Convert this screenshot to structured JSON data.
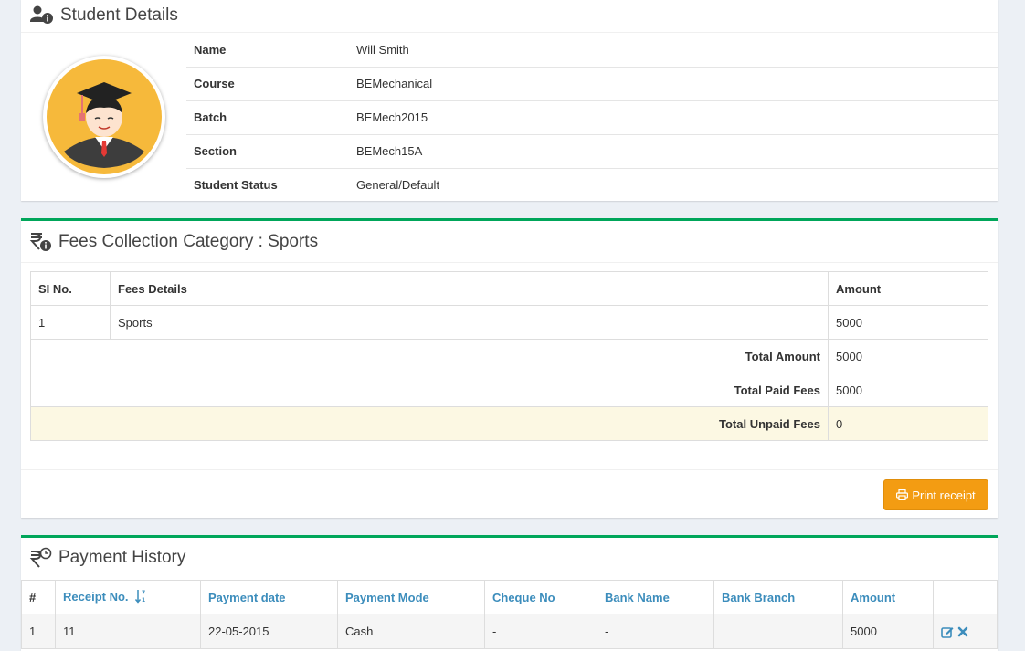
{
  "student": {
    "title": "Student Details",
    "rows": [
      {
        "label": "Name",
        "value": "Will Smith"
      },
      {
        "label": "Course",
        "value": "BEMechanical"
      },
      {
        "label": "Batch",
        "value": "BEMech2015"
      },
      {
        "label": "Section",
        "value": "BEMech15A"
      },
      {
        "label": "Student Status",
        "value": "General/Default"
      }
    ],
    "avatar_icon": "graduate-avatar-icon"
  },
  "fees": {
    "title": "Fees Collection Category : Sports",
    "headers": [
      "SI No.",
      "Fees Details",
      "Amount"
    ],
    "rows": [
      {
        "si": "1",
        "details": "Sports",
        "amount": "5000"
      }
    ],
    "totals": [
      {
        "label": "Total Amount",
        "value": "5000"
      },
      {
        "label": "Total Paid Fees",
        "value": "5000"
      },
      {
        "label": "Total Unpaid Fees",
        "value": "0"
      }
    ],
    "print_button": "Print receipt"
  },
  "history": {
    "title": "Payment History",
    "headers": [
      "#",
      "Receipt No.",
      "Payment date",
      "Payment Mode",
      "Cheque No",
      "Bank Name",
      "Bank Branch",
      "Amount",
      ""
    ],
    "rows": [
      {
        "num": "1",
        "receipt": "11",
        "date": "22-05-2015",
        "mode": "Cash",
        "cheque": "-",
        "bank": "-",
        "branch": "",
        "amount": "5000"
      }
    ]
  },
  "colors": {
    "accent_green": "#00a65a",
    "link_blue": "#3c8dbc",
    "print_orange": "#f39c12",
    "warning_row": "#fcf8e3"
  }
}
